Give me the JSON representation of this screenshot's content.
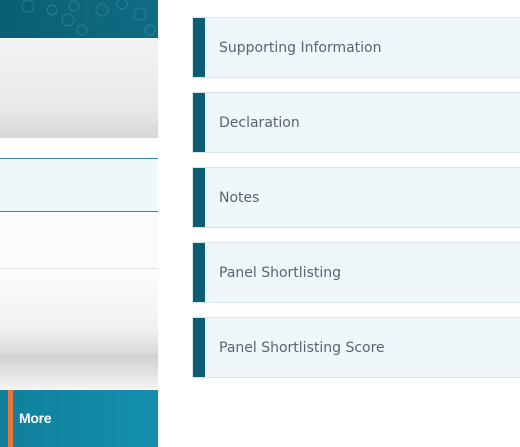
{
  "colors": {
    "accent_teal_dark": "#0d5d72",
    "accent_teal": "#1390ae",
    "accent_orange": "#e8743b",
    "item_bg": "#f0f7fb",
    "item_text": "#5a6470"
  },
  "sidebar": {
    "more_label": "More"
  },
  "sections": [
    {
      "label": "Supporting Information"
    },
    {
      "label": "Declaration"
    },
    {
      "label": "Notes"
    },
    {
      "label": "Panel Shortlisting"
    },
    {
      "label": "Panel Shortlisting Score"
    }
  ]
}
